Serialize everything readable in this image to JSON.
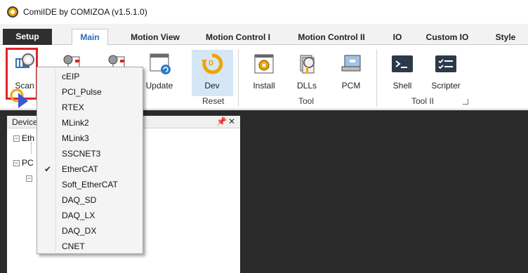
{
  "window": {
    "title": "ComiIDE by COMIZOA (v1.5.1.0)"
  },
  "tabs": [
    {
      "label": "Setup"
    },
    {
      "label": "Main"
    },
    {
      "label": "Motion View"
    },
    {
      "label": "Motion Control I"
    },
    {
      "label": "Motion Control II"
    },
    {
      "label": "IO"
    },
    {
      "label": "Custom IO"
    },
    {
      "label": "Style"
    }
  ],
  "ribbon": {
    "scan_label": "Scan",
    "update_label": "Update",
    "dev_label": "Dev",
    "install_label": "Install",
    "dlls_label": "DLLs",
    "pcm_label": "PCM",
    "shell_label": "Shell",
    "scripter_label": "Scripter",
    "groups": {
      "reset": "Reset",
      "tool": "Tool",
      "tool2": "Tool II"
    }
  },
  "panel": {
    "title": "Device",
    "tree": [
      {
        "label": "Eth"
      },
      {
        "label": "PC"
      }
    ]
  },
  "dropdown": {
    "items": [
      {
        "label": "cEIP",
        "checked": false
      },
      {
        "label": "PCI_Pulse",
        "checked": false
      },
      {
        "label": "RTEX",
        "checked": false
      },
      {
        "label": "MLink2",
        "checked": false
      },
      {
        "label": "MLink3",
        "checked": false
      },
      {
        "label": "SSCNET3",
        "checked": false
      },
      {
        "label": "EtherCAT",
        "checked": true
      },
      {
        "label": "Soft_EtherCAT",
        "checked": false
      },
      {
        "label": "DAQ_SD",
        "checked": false
      },
      {
        "label": "DAQ_LX",
        "checked": false
      },
      {
        "label": "DAQ_DX",
        "checked": false
      },
      {
        "label": "CNET",
        "checked": false
      }
    ],
    "check_glyph": "✔"
  },
  "colors": {
    "accent": "#2b6cb4",
    "highlight": "#e0232a",
    "selected_bg": "#d5e7f6"
  }
}
